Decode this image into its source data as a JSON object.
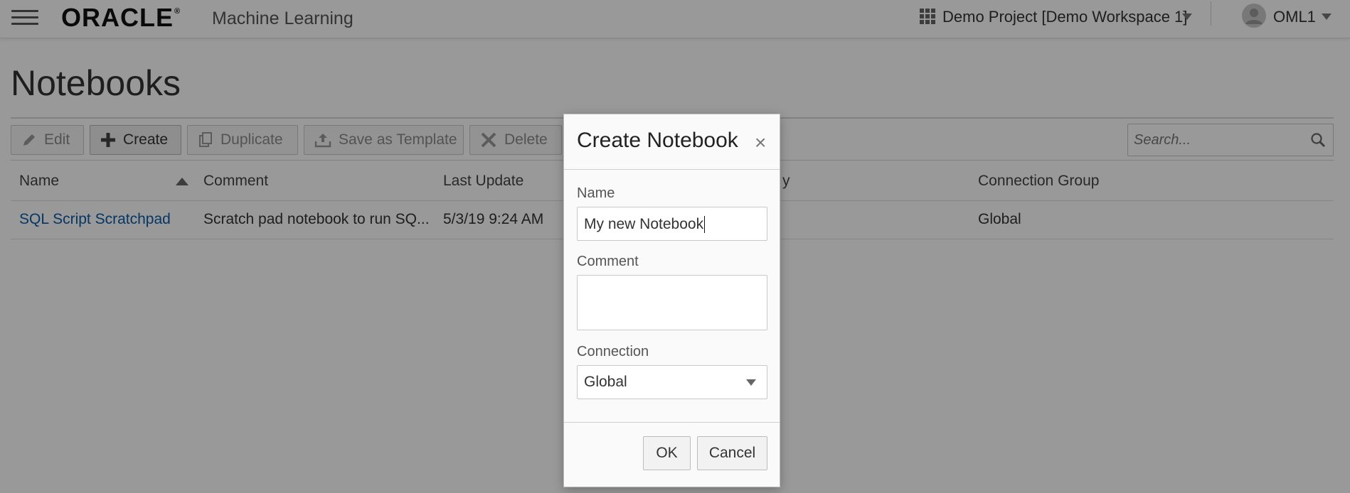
{
  "header": {
    "logo": "ORACLE",
    "logo_mark": "®",
    "product": "Machine Learning",
    "project": "Demo Project [Demo Workspace 1]",
    "user": "OML1"
  },
  "page": {
    "title": "Notebooks"
  },
  "toolbar": {
    "edit": "Edit",
    "create": "Create",
    "duplicate": "Duplicate",
    "save_as_template": "Save as Template",
    "delete": "Delete"
  },
  "search": {
    "placeholder": "Search..."
  },
  "table": {
    "columns": {
      "name": "Name",
      "comment": "Comment",
      "last_update": "Last Update",
      "updated_by_partial": "y",
      "connection_group": "Connection Group"
    },
    "rows": [
      {
        "name": "SQL Script Scratchpad",
        "comment": "Scratch pad notebook to run SQ...",
        "last_update": "5/3/19 9:24 AM",
        "connection_group": "Global"
      }
    ]
  },
  "dialog": {
    "title": "Create Notebook",
    "close": "×",
    "name_label": "Name",
    "name_value": "My new Notebook",
    "comment_label": "Comment",
    "comment_value": "",
    "connection_label": "Connection",
    "connection_value": "Global",
    "ok": "OK",
    "cancel": "Cancel"
  },
  "colors": {
    "link": "#0a5aa6",
    "overlay": "rgba(0,0,0,0.40)"
  }
}
